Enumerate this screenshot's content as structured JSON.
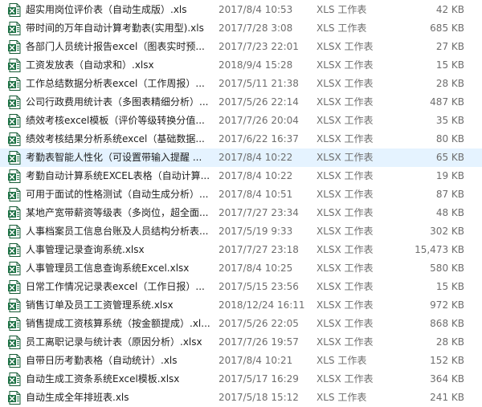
{
  "files": [
    {
      "name": "超实用岗位评价表（自动生成版）.xls",
      "modified": "2017/8/4 10:53",
      "type": "XLS 工作表",
      "size": "42 KB",
      "icon": "excel-file-icon",
      "selected": false
    },
    {
      "name": "带时间的万年自动计算考勤表(实用型).xls",
      "modified": "2017/7/28 3:08",
      "type": "XLS 工作表",
      "size": "685 KB",
      "icon": "excel-file-icon",
      "selected": false
    },
    {
      "name": "各部门人员统计报告excel（图表实时预...",
      "modified": "2017/7/23 22:01",
      "type": "XLSX 工作表",
      "size": "27 KB",
      "icon": "excel-file-icon",
      "selected": false
    },
    {
      "name": "工资发放表（自动求和）.xlsx",
      "modified": "2018/9/4 15:28",
      "type": "XLSX 工作表",
      "size": "15 KB",
      "icon": "excel-file-icon",
      "selected": false
    },
    {
      "name": "工作总结数据分析表excel（工作周报）...",
      "modified": "2017/5/11 21:38",
      "type": "XLSX 工作表",
      "size": "28 KB",
      "icon": "excel-file-icon",
      "selected": false
    },
    {
      "name": "公司行政费用统计表（多图表精细分析）...",
      "modified": "2017/5/26 22:14",
      "type": "XLSX 工作表",
      "size": "487 KB",
      "icon": "excel-file-icon",
      "selected": false
    },
    {
      "name": "绩效考核excel模板（评价等级转换分值...",
      "modified": "2017/7/26 20:04",
      "type": "XLSX 工作表",
      "size": "35 KB",
      "icon": "excel-file-icon",
      "selected": false
    },
    {
      "name": "绩效考核结果分析系统excel（基础数据...",
      "modified": "2017/6/22 16:37",
      "type": "XLSX 工作表",
      "size": "80 KB",
      "icon": "excel-file-icon",
      "selected": false
    },
    {
      "name": "考勤表智能人性化（可设置带输入提醒 ...",
      "modified": "2017/8/4 10:22",
      "type": "XLSX 工作表",
      "size": "65 KB",
      "icon": "excel-file-icon",
      "selected": true
    },
    {
      "name": "考勤自动计算系统EXCEL表格（自动计算...",
      "modified": "2017/8/4 10:22",
      "type": "XLSX 工作表",
      "size": "19 KB",
      "icon": "excel-file-icon",
      "selected": false
    },
    {
      "name": "可用于面试的性格测试（自动生成分析）...",
      "modified": "2017/8/4 10:51",
      "type": "XLSX 工作表",
      "size": "87 KB",
      "icon": "excel-file-icon",
      "selected": false
    },
    {
      "name": "某地产宽带薪资等级表（多岗位，超全面...",
      "modified": "2017/7/27 23:34",
      "type": "XLSX 工作表",
      "size": "48 KB",
      "icon": "excel-file-icon",
      "selected": false
    },
    {
      "name": "人事档案员工信息台账及人员结构分析表...",
      "modified": "2017/5/19 9:33",
      "type": "XLSX 工作表",
      "size": "302 KB",
      "icon": "excel-file-icon",
      "selected": false
    },
    {
      "name": "人事管理记录查询系统.xlsx",
      "modified": "2017/7/27 23:18",
      "type": "XLSX 工作表",
      "size": "15,473 KB",
      "icon": "excel-file-icon",
      "selected": false
    },
    {
      "name": "人事管理员工信息查询系统Excel.xlsx",
      "modified": "2017/8/4 10:25",
      "type": "XLSX 工作表",
      "size": "580 KB",
      "icon": "excel-file-icon",
      "selected": false
    },
    {
      "name": "日常工作情况记录表excel（工作日报）...",
      "modified": "2017/5/15 23:56",
      "type": "XLSX 工作表",
      "size": "15 KB",
      "icon": "excel-file-icon",
      "selected": false
    },
    {
      "name": "销售订单及员工工资管理系统.xlsx",
      "modified": "2018/12/24 16:11",
      "type": "XLSX 工作表",
      "size": "972 KB",
      "icon": "excel-file-icon",
      "selected": false
    },
    {
      "name": "销售提成工资核算系统（按金额提成）.xl...",
      "modified": "2017/5/26 22:05",
      "type": "XLSX 工作表",
      "size": "868 KB",
      "icon": "excel-file-icon",
      "selected": false
    },
    {
      "name": "员工离职记录与统计表（原因分析）.xlsx",
      "modified": "2017/7/26 19:57",
      "type": "XLSX 工作表",
      "size": "28 KB",
      "icon": "excel-file-icon",
      "selected": false
    },
    {
      "name": "自带日历考勤表格（自动统计）.xls",
      "modified": "2017/8/4 10:21",
      "type": "XLS 工作表",
      "size": "152 KB",
      "icon": "excel-file-icon",
      "selected": false
    },
    {
      "name": "自动生成工资条系统Excel模板.xlsx",
      "modified": "2017/5/17 16:29",
      "type": "XLSX 工作表",
      "size": "364 KB",
      "icon": "excel-file-icon",
      "selected": false
    },
    {
      "name": "自动生成全年排班表.xls",
      "modified": "2017/5/18 15:12",
      "type": "XLS 工作表",
      "size": "241 KB",
      "icon": "excel-file-icon",
      "selected": false
    }
  ],
  "colors": {
    "excel_green": "#1e7145",
    "excel_green_dark": "#185c37",
    "selection": "#e5f3ff",
    "text": "#1e1e1e",
    "muted": "#6d6d6d"
  }
}
